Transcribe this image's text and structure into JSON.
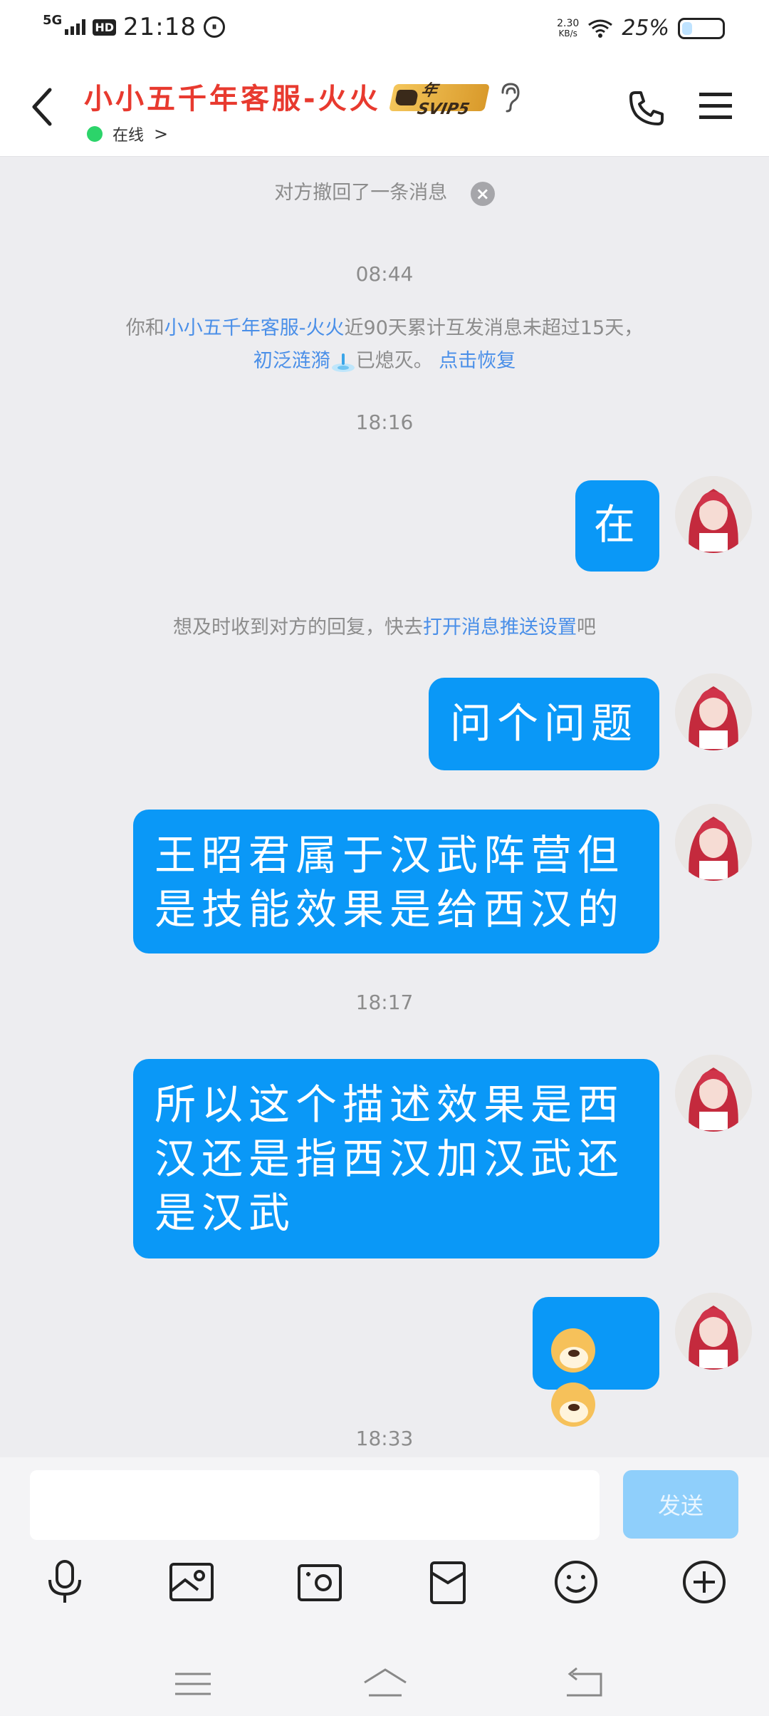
{
  "status_bar": {
    "network": "5G",
    "hd": "HD",
    "time": "21:18",
    "speed_value": "2.30",
    "speed_unit": "KB/s",
    "battery_pct": "25%",
    "battery_level": 0.25
  },
  "header": {
    "title": "小小五千年客服-火火",
    "vip_label": "年SVIP5",
    "status_label": "在线",
    "status_chevron": ">"
  },
  "chat": {
    "recall_notice": "对方撤回了一条消息",
    "ts_1": "08:44",
    "streak_notice": {
      "prefix": "你和",
      "name": "小小五千年客服-火火",
      "middle": "近90天累计互发消息未超过15天，",
      "flame": "初泛涟漪",
      "suffix": "已熄灭。",
      "restore": "点击恢复"
    },
    "ts_2": "18:16",
    "msg_1": "在",
    "push_notice": {
      "prefix": "想及时收到对方的回复，快去",
      "link": "打开消息推送设置",
      "suffix": "吧"
    },
    "msg_2": "问个问题",
    "msg_3_line1": "王昭君属于汉武阵营但",
    "msg_3_line2": "是技能效果是给西汉的",
    "ts_3": "18:17",
    "msg_4_line1": "所以这个描述效果是西",
    "msg_4_line2": "汉还是指西汉加汉武还",
    "msg_4_line3": "是汉武",
    "ts_4": "18:33"
  },
  "composer": {
    "input_value": "",
    "send_label": "发送"
  },
  "icons": {
    "toolbar": [
      "microphone-icon",
      "image-icon",
      "camera-icon",
      "red-packet-icon",
      "emoji-icon",
      "plus-icon"
    ],
    "nav": [
      "menu-nav-icon",
      "home-nav-icon",
      "back-nav-icon"
    ]
  },
  "colors": {
    "bubble": "#0A98F7",
    "title": "#E83A2F",
    "link": "#4A8FE8",
    "online": "#2CD46A",
    "send_disabled": "#8FCFFB"
  }
}
